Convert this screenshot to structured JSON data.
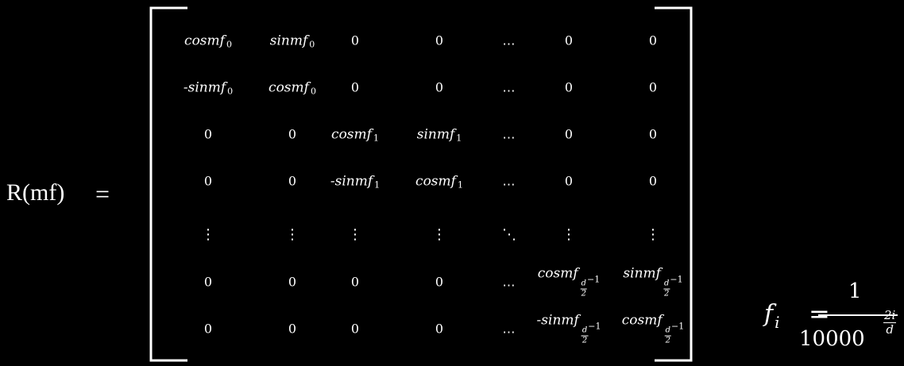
{
  "lhs": "R(mf)",
  "equals": "=",
  "matrix": {
    "rows": [
      [
        {
          "t": "tf",
          "fn": "cos",
          "s": "0"
        },
        {
          "t": "tf",
          "fn": "sin",
          "s": "0"
        },
        {
          "t": "n",
          "v": "0"
        },
        {
          "t": "n",
          "v": "0"
        },
        {
          "t": "h",
          "v": "…"
        },
        {
          "t": "n",
          "v": "0"
        },
        {
          "t": "n",
          "v": "0"
        }
      ],
      [
        {
          "t": "tf",
          "fn": "-sin",
          "s": "0"
        },
        {
          "t": "tf",
          "fn": "cos",
          "s": "0"
        },
        {
          "t": "n",
          "v": "0"
        },
        {
          "t": "n",
          "v": "0"
        },
        {
          "t": "h",
          "v": "…"
        },
        {
          "t": "n",
          "v": "0"
        },
        {
          "t": "n",
          "v": "0"
        }
      ],
      [
        {
          "t": "n",
          "v": "0"
        },
        {
          "t": "n",
          "v": "0"
        },
        {
          "t": "tf",
          "fn": "cos",
          "s": "1"
        },
        {
          "t": "tf",
          "fn": "sin",
          "s": "1"
        },
        {
          "t": "h",
          "v": "…"
        },
        {
          "t": "n",
          "v": "0"
        },
        {
          "t": "n",
          "v": "0"
        }
      ],
      [
        {
          "t": "n",
          "v": "0"
        },
        {
          "t": "n",
          "v": "0"
        },
        {
          "t": "tf",
          "fn": "-sin",
          "s": "1"
        },
        {
          "t": "tf",
          "fn": "cos",
          "s": "1"
        },
        {
          "t": "h",
          "v": "…"
        },
        {
          "t": "n",
          "v": "0"
        },
        {
          "t": "n",
          "v": "0"
        }
      ],
      [
        {
          "t": "v",
          "v": "⋮"
        },
        {
          "t": "v",
          "v": "⋮"
        },
        {
          "t": "v",
          "v": "⋮"
        },
        {
          "t": "v",
          "v": "⋮"
        },
        {
          "t": "d",
          "v": "⋱"
        },
        {
          "t": "v",
          "v": "⋮"
        },
        {
          "t": "v",
          "v": "⋮"
        }
      ],
      [
        {
          "t": "n",
          "v": "0"
        },
        {
          "t": "n",
          "v": "0"
        },
        {
          "t": "n",
          "v": "0"
        },
        {
          "t": "n",
          "v": "0"
        },
        {
          "t": "h",
          "v": "…"
        },
        {
          "t": "tfd",
          "fn": "cos",
          "fn_top": "d",
          "fn_bot": "2",
          "tail": "−1"
        },
        {
          "t": "tfd",
          "fn": "sin",
          "fn_top": "d",
          "fn_bot": "2",
          "tail": "−1"
        }
      ],
      [
        {
          "t": "n",
          "v": "0"
        },
        {
          "t": "n",
          "v": "0"
        },
        {
          "t": "n",
          "v": "0"
        },
        {
          "t": "n",
          "v": "0"
        },
        {
          "t": "h",
          "v": "…"
        },
        {
          "t": "tfd",
          "fn": "-sin",
          "fn_top": "d",
          "fn_bot": "2",
          "tail": "−1"
        },
        {
          "t": "tfd",
          "fn": "cos",
          "fn_top": "d",
          "fn_bot": "2",
          "tail": "−1"
        }
      ]
    ],
    "arg": "mf"
  },
  "formula": {
    "lhs_var": "f",
    "lhs_sub": "i",
    "equals": "=",
    "numerator": "1",
    "base": "10000",
    "exp_num": "2i",
    "exp_den": "d"
  }
}
